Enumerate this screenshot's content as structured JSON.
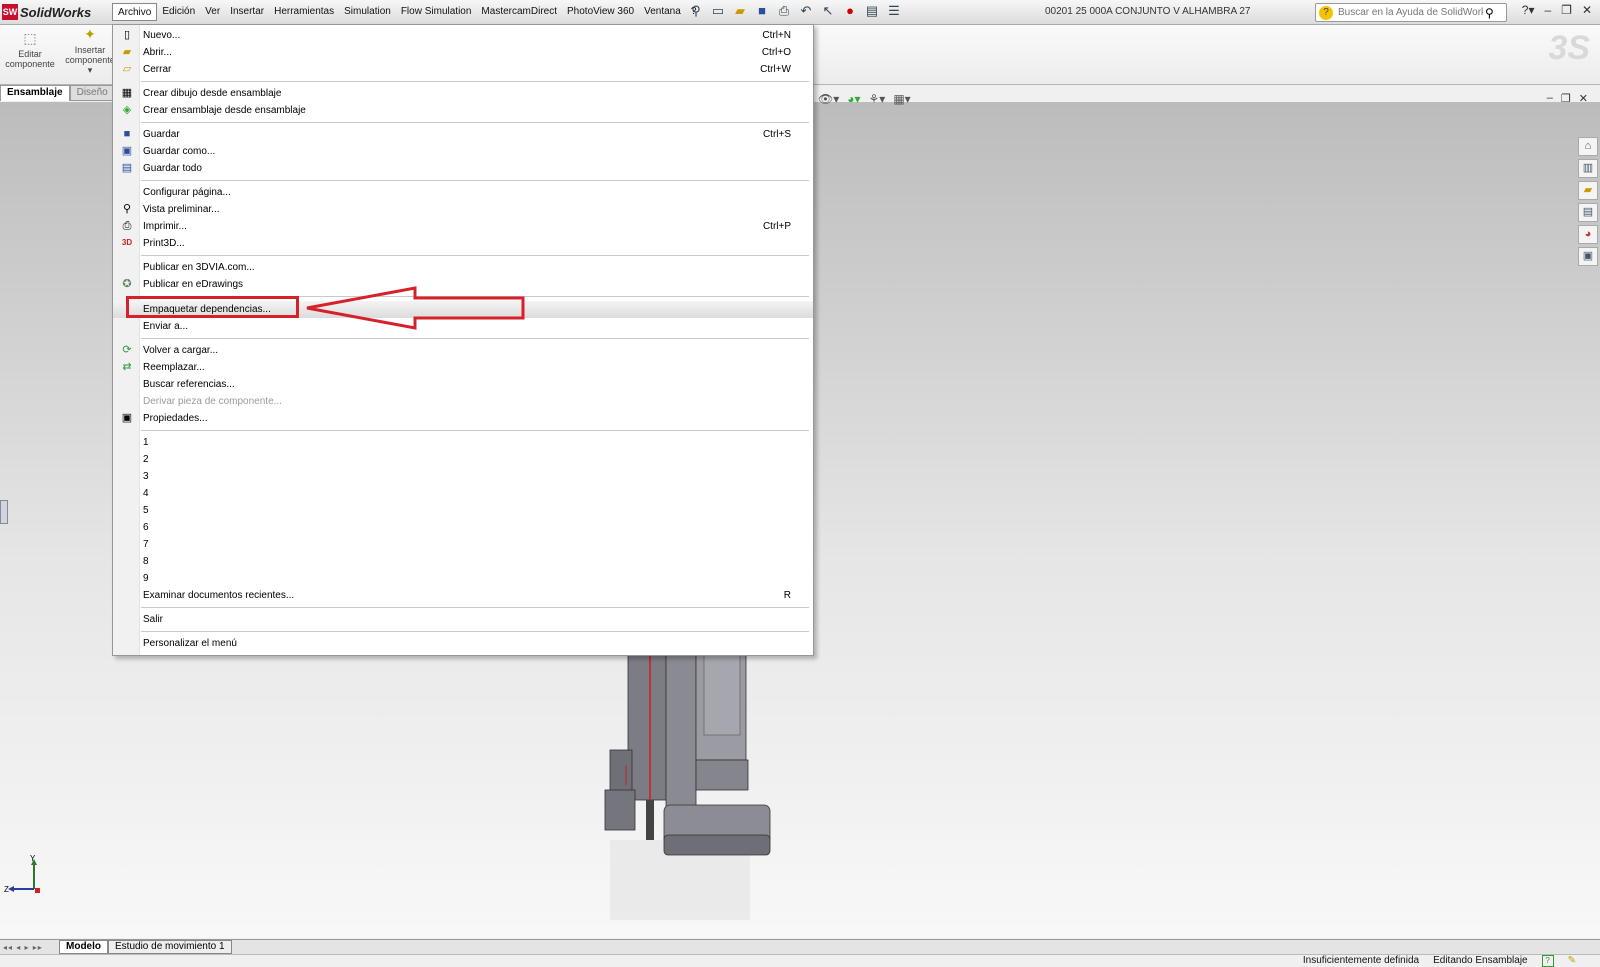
{
  "app": {
    "name": "SolidWorks",
    "doc_title": "00201 25 000A CONJUNTO V ALHAMBRA 27",
    "accent": "#c8102e"
  },
  "menubar": [
    {
      "label": "Archivo",
      "active": true
    },
    {
      "label": "Edición"
    },
    {
      "label": "Ver"
    },
    {
      "label": "Insertar"
    },
    {
      "label": "Herramientas"
    },
    {
      "label": "Simulation"
    },
    {
      "label": "Flow Simulation"
    },
    {
      "label": "MastercamDirect"
    },
    {
      "label": "PhotoView 360"
    },
    {
      "label": "Ventana"
    },
    {
      "label": "?"
    }
  ],
  "help_search": {
    "placeholder": "Buscar en la Ayuda de SolidWorks"
  },
  "command_manager": {
    "buttons": [
      {
        "line1": "Editar",
        "line2": "componente"
      },
      {
        "line1": "Insertar",
        "line2": "componente"
      }
    ],
    "tabs": [
      "Ensamblaje",
      "Diseño"
    ]
  },
  "file_menu": {
    "items": [
      {
        "label": "Nuevo...",
        "shortcut": "Ctrl+N",
        "icon": "new-doc-icon"
      },
      {
        "label": "Abrir...",
        "shortcut": "Ctrl+O",
        "icon": "open-folder-icon"
      },
      {
        "label": "Cerrar",
        "shortcut": "Ctrl+W",
        "icon": "close-folder-icon"
      },
      {
        "label": "Crear dibujo desde ensamblaje",
        "shortcut": "",
        "icon": "drawing-icon"
      },
      {
        "label": "Crear ensamblaje desde ensamblaje",
        "shortcut": "",
        "icon": "assembly-icon"
      },
      {
        "label": "Guardar",
        "shortcut": "Ctrl+S",
        "icon": "save-icon"
      },
      {
        "label": "Guardar como...",
        "shortcut": "",
        "icon": "save-as-icon"
      },
      {
        "label": "Guardar todo",
        "shortcut": "",
        "icon": "save-all-icon"
      },
      {
        "label": "Configurar página...",
        "shortcut": "",
        "icon": ""
      },
      {
        "label": "Vista preliminar...",
        "shortcut": "",
        "icon": "print-preview-icon"
      },
      {
        "label": "Imprimir...",
        "shortcut": "Ctrl+P",
        "icon": "printer-icon"
      },
      {
        "label": "Print3D...",
        "shortcut": "",
        "icon": "print3d-icon"
      },
      {
        "label": "Publicar en 3DVIA.com...",
        "shortcut": "",
        "icon": ""
      },
      {
        "label": "Publicar en eDrawings",
        "shortcut": "",
        "icon": "edrawings-icon"
      },
      {
        "label": "Empaquetar dependencias...",
        "shortcut": "",
        "icon": ""
      },
      {
        "label": "Enviar a...",
        "shortcut": "",
        "icon": ""
      },
      {
        "label": "Volver a cargar...",
        "shortcut": "",
        "icon": "reload-icon"
      },
      {
        "label": "Reemplazar...",
        "shortcut": "",
        "icon": "replace-icon"
      },
      {
        "label": "Buscar referencias...",
        "shortcut": "",
        "icon": ""
      },
      {
        "label": "Derivar pieza de componente...",
        "shortcut": "",
        "icon": "",
        "disabled": true
      },
      {
        "label": "Propiedades...",
        "shortcut": "",
        "icon": "properties-icon"
      },
      {
        "label": "1",
        "shortcut": ""
      },
      {
        "label": "2",
        "shortcut": ""
      },
      {
        "label": "3",
        "shortcut": ""
      },
      {
        "label": "4",
        "shortcut": ""
      },
      {
        "label": "5",
        "shortcut": ""
      },
      {
        "label": "6",
        "shortcut": ""
      },
      {
        "label": "7",
        "shortcut": ""
      },
      {
        "label": "8",
        "shortcut": ""
      },
      {
        "label": "9",
        "shortcut": ""
      },
      {
        "label": "Examinar documentos recientes...",
        "shortcut": "R"
      },
      {
        "label": "Salir",
        "shortcut": ""
      },
      {
        "label": "Personalizar el menú",
        "shortcut": ""
      }
    ],
    "highlighted_item": "Empaquetar dependencias..."
  },
  "triad": {
    "y": "Y",
    "z": "Z"
  },
  "bottom_tabs": [
    "Modelo",
    "Estudio de movimiento 1"
  ],
  "status": {
    "definition": "Insuficientemente definida",
    "mode": "Editando Ensamblaje"
  },
  "colors": {
    "annotation_red": "#d7202a",
    "menu_gutter": "#f1f1f1"
  }
}
